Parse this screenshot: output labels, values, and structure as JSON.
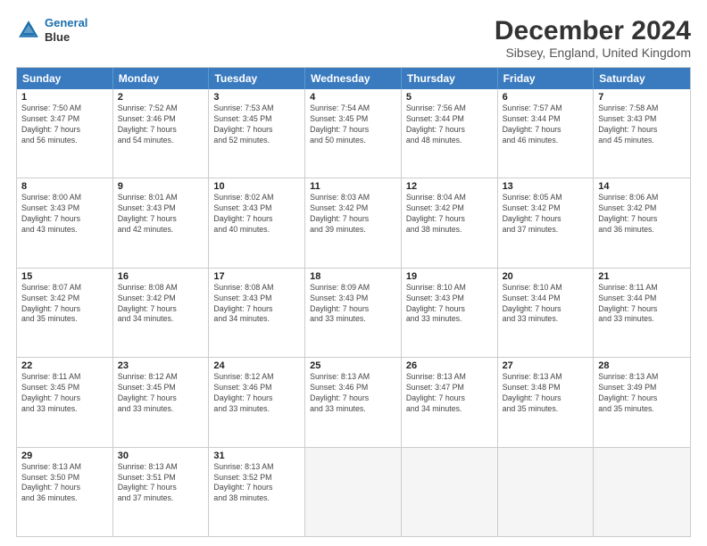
{
  "header": {
    "logo_line1": "General",
    "logo_line2": "Blue",
    "title": "December 2024",
    "subtitle": "Sibsey, England, United Kingdom"
  },
  "calendar": {
    "days_of_week": [
      "Sunday",
      "Monday",
      "Tuesday",
      "Wednesday",
      "Thursday",
      "Friday",
      "Saturday"
    ],
    "weeks": [
      [
        {
          "day": "",
          "info": ""
        },
        {
          "day": "2",
          "info": "Sunrise: 7:52 AM\nSunset: 3:46 PM\nDaylight: 7 hours\nand 54 minutes."
        },
        {
          "day": "3",
          "info": "Sunrise: 7:53 AM\nSunset: 3:45 PM\nDaylight: 7 hours\nand 52 minutes."
        },
        {
          "day": "4",
          "info": "Sunrise: 7:54 AM\nSunset: 3:45 PM\nDaylight: 7 hours\nand 50 minutes."
        },
        {
          "day": "5",
          "info": "Sunrise: 7:56 AM\nSunset: 3:44 PM\nDaylight: 7 hours\nand 48 minutes."
        },
        {
          "day": "6",
          "info": "Sunrise: 7:57 AM\nSunset: 3:44 PM\nDaylight: 7 hours\nand 46 minutes."
        },
        {
          "day": "7",
          "info": "Sunrise: 7:58 AM\nSunset: 3:43 PM\nDaylight: 7 hours\nand 45 minutes."
        }
      ],
      [
        {
          "day": "8",
          "info": "Sunrise: 8:00 AM\nSunset: 3:43 PM\nDaylight: 7 hours\nand 43 minutes."
        },
        {
          "day": "9",
          "info": "Sunrise: 8:01 AM\nSunset: 3:43 PM\nDaylight: 7 hours\nand 42 minutes."
        },
        {
          "day": "10",
          "info": "Sunrise: 8:02 AM\nSunset: 3:43 PM\nDaylight: 7 hours\nand 40 minutes."
        },
        {
          "day": "11",
          "info": "Sunrise: 8:03 AM\nSunset: 3:42 PM\nDaylight: 7 hours\nand 39 minutes."
        },
        {
          "day": "12",
          "info": "Sunrise: 8:04 AM\nSunset: 3:42 PM\nDaylight: 7 hours\nand 38 minutes."
        },
        {
          "day": "13",
          "info": "Sunrise: 8:05 AM\nSunset: 3:42 PM\nDaylight: 7 hours\nand 37 minutes."
        },
        {
          "day": "14",
          "info": "Sunrise: 8:06 AM\nSunset: 3:42 PM\nDaylight: 7 hours\nand 36 minutes."
        }
      ],
      [
        {
          "day": "15",
          "info": "Sunrise: 8:07 AM\nSunset: 3:42 PM\nDaylight: 7 hours\nand 35 minutes."
        },
        {
          "day": "16",
          "info": "Sunrise: 8:08 AM\nSunset: 3:42 PM\nDaylight: 7 hours\nand 34 minutes."
        },
        {
          "day": "17",
          "info": "Sunrise: 8:08 AM\nSunset: 3:43 PM\nDaylight: 7 hours\nand 34 minutes."
        },
        {
          "day": "18",
          "info": "Sunrise: 8:09 AM\nSunset: 3:43 PM\nDaylight: 7 hours\nand 33 minutes."
        },
        {
          "day": "19",
          "info": "Sunrise: 8:10 AM\nSunset: 3:43 PM\nDaylight: 7 hours\nand 33 minutes."
        },
        {
          "day": "20",
          "info": "Sunrise: 8:10 AM\nSunset: 3:44 PM\nDaylight: 7 hours\nand 33 minutes."
        },
        {
          "day": "21",
          "info": "Sunrise: 8:11 AM\nSunset: 3:44 PM\nDaylight: 7 hours\nand 33 minutes."
        }
      ],
      [
        {
          "day": "22",
          "info": "Sunrise: 8:11 AM\nSunset: 3:45 PM\nDaylight: 7 hours\nand 33 minutes."
        },
        {
          "day": "23",
          "info": "Sunrise: 8:12 AM\nSunset: 3:45 PM\nDaylight: 7 hours\nand 33 minutes."
        },
        {
          "day": "24",
          "info": "Sunrise: 8:12 AM\nSunset: 3:46 PM\nDaylight: 7 hours\nand 33 minutes."
        },
        {
          "day": "25",
          "info": "Sunrise: 8:13 AM\nSunset: 3:46 PM\nDaylight: 7 hours\nand 33 minutes."
        },
        {
          "day": "26",
          "info": "Sunrise: 8:13 AM\nSunset: 3:47 PM\nDaylight: 7 hours\nand 34 minutes."
        },
        {
          "day": "27",
          "info": "Sunrise: 8:13 AM\nSunset: 3:48 PM\nDaylight: 7 hours\nand 35 minutes."
        },
        {
          "day": "28",
          "info": "Sunrise: 8:13 AM\nSunset: 3:49 PM\nDaylight: 7 hours\nand 35 minutes."
        }
      ],
      [
        {
          "day": "29",
          "info": "Sunrise: 8:13 AM\nSunset: 3:50 PM\nDaylight: 7 hours\nand 36 minutes."
        },
        {
          "day": "30",
          "info": "Sunrise: 8:13 AM\nSunset: 3:51 PM\nDaylight: 7 hours\nand 37 minutes."
        },
        {
          "day": "31",
          "info": "Sunrise: 8:13 AM\nSunset: 3:52 PM\nDaylight: 7 hours\nand 38 minutes."
        },
        {
          "day": "",
          "info": ""
        },
        {
          "day": "",
          "info": ""
        },
        {
          "day": "",
          "info": ""
        },
        {
          "day": "",
          "info": ""
        }
      ]
    ],
    "week1_day1": {
      "day": "1",
      "info": "Sunrise: 7:50 AM\nSunset: 3:47 PM\nDaylight: 7 hours\nand 56 minutes."
    }
  }
}
